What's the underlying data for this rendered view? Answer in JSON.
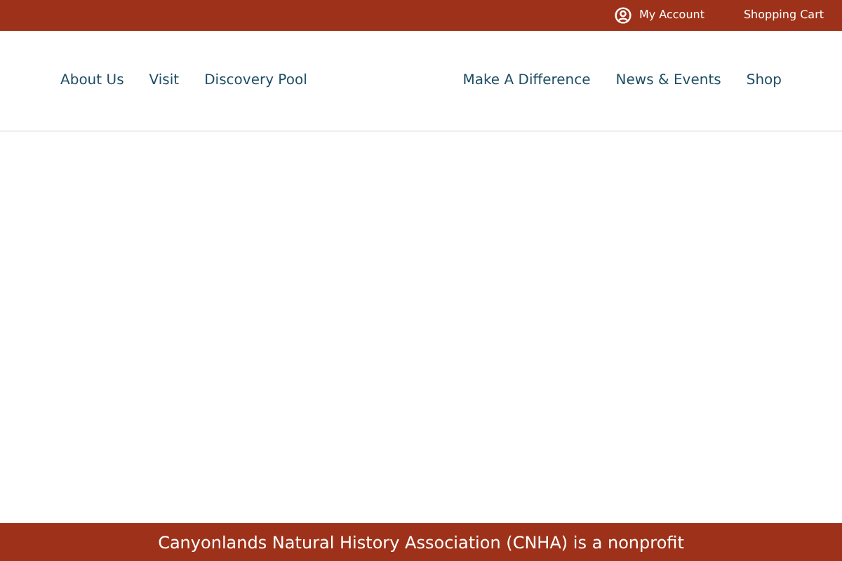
{
  "top_bar": {
    "account": "My Account",
    "cart": "Shopping Cart"
  },
  "nav_left": [
    "About Us",
    "Visit",
    "Discovery Pool"
  ],
  "nav_right": [
    "Make A Difference",
    "News & Events",
    "Shop"
  ],
  "footer": {
    "text": "Canyonlands Natural History Association (CNHA) is a nonprofit"
  }
}
